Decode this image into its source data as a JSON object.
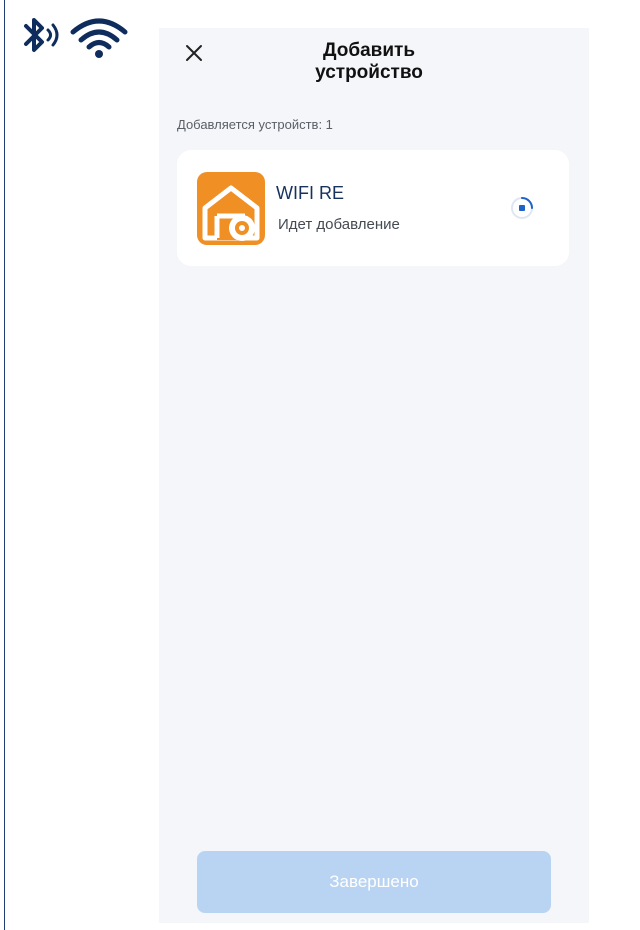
{
  "status_bar": {
    "bluetooth_icon": "bluetooth-audio-icon",
    "wifi_icon": "wifi-icon",
    "icon_color": "#0f2d5c"
  },
  "header": {
    "title": "Добавить устройство",
    "close_icon": "close-icon"
  },
  "device_count": "Добавляется устройств: 1",
  "devices": [
    {
      "name": "WIFI RE",
      "status": "Идет добавление",
      "icon": "garage-gear-icon",
      "icon_color": "#ef8f24"
    }
  ],
  "finish_button": {
    "label": "Завершено",
    "color": "#b9d4f2"
  }
}
